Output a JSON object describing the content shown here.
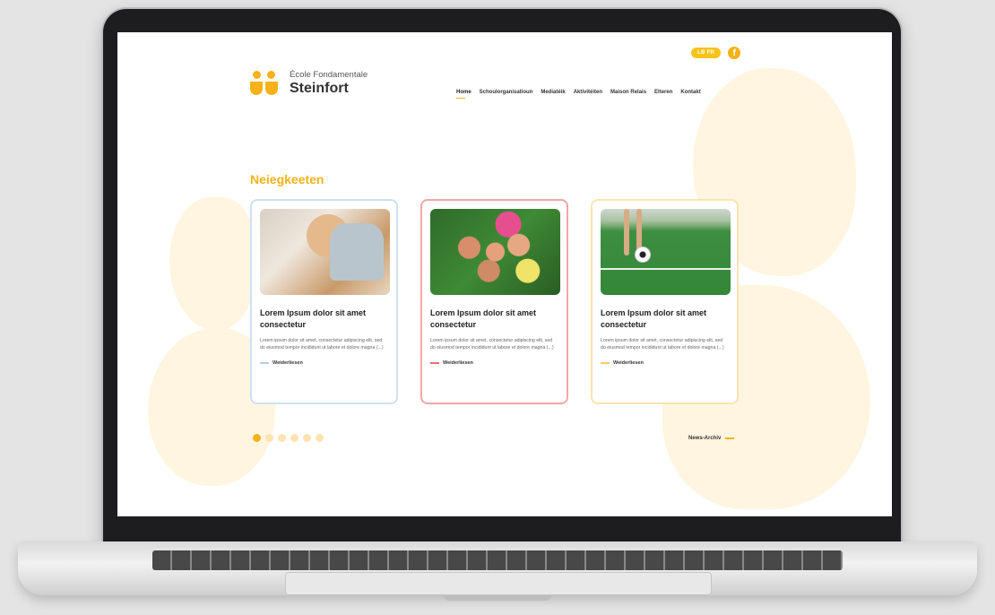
{
  "header": {
    "lang_label": "LB FR",
    "logo": {
      "line1": "École Fondamentale",
      "line2": "Steinfort"
    },
    "nav": [
      "Home",
      "Schoulorganisatioun",
      "Mediatéik",
      "Aktivitéiten",
      "Maison Relais",
      "Elteren",
      "Kontakt"
    ]
  },
  "main": {
    "section_title": "Neiegkeeten",
    "cards": [
      {
        "title": "Lorem Ipsum dolor sit amet consectetur",
        "text": "Lorem ipsum dolor sit amet, consectetur adipiscing elit, sed do eiusmod tempor incididunt ut labore et dolore magna (...)",
        "link": "Weiderliesen"
      },
      {
        "title": "Lorem Ipsum dolor sit amet consectetur",
        "text": "Lorem ipsum dolor sit amet, consectetur adipiscing elit, sed do eiusmod tempor incididunt ut labore et dolore magna (...)",
        "link": "Weiderliesen"
      },
      {
        "title": "Lorem Ipsum dolor sit amet consectetur",
        "text": "Lorem ipsum dolor sit amet, consectetur adipiscing elit, sed do eiusmod tempor incididunt ut labore et dolore magna (...)",
        "link": "Weiderliesen"
      }
    ],
    "archive_link": "News-Archiv"
  },
  "colors": {
    "accent": "#f7b219",
    "card_blue": "#cfe0f4",
    "card_red": "#f2a7a7",
    "card_yellow": "#fde3b0"
  },
  "icons": {
    "social": "facebook-icon"
  }
}
